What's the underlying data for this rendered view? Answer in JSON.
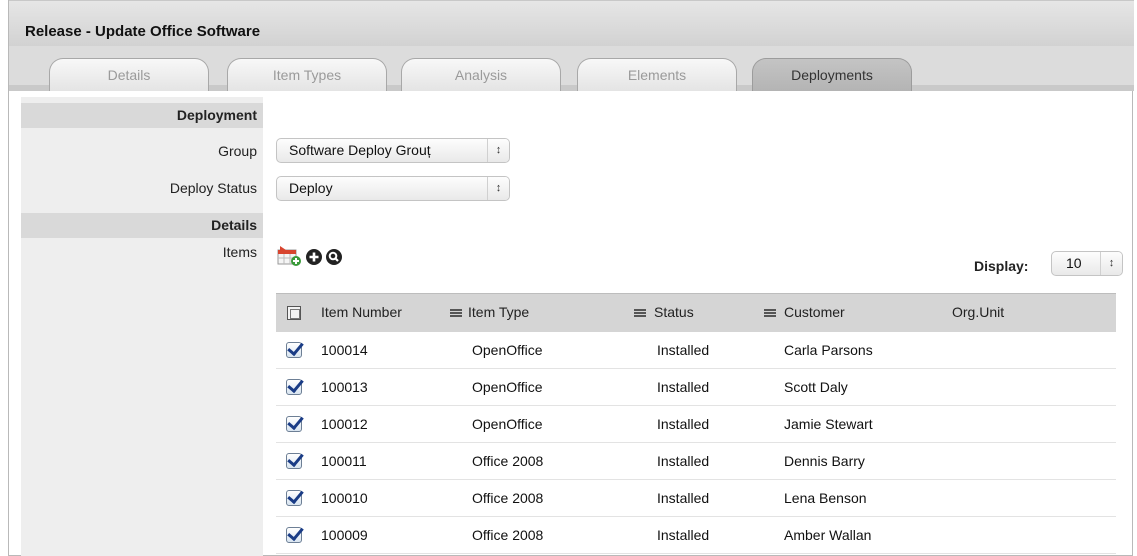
{
  "window": {
    "title": "Release - Update Office Software"
  },
  "tabs": [
    {
      "label": "Details",
      "active": false
    },
    {
      "label": "Item Types",
      "active": false
    },
    {
      "label": "Analysis",
      "active": false
    },
    {
      "label": "Elements",
      "active": false
    },
    {
      "label": "Deployments",
      "active": true
    }
  ],
  "deployment": {
    "section_label": "Deployment",
    "group_label": "Group",
    "group_value": "Software Deploy Grouț",
    "status_label": "Deploy Status",
    "status_value": "Deploy"
  },
  "details": {
    "section_label": "Details",
    "items_label": "Items"
  },
  "toolbar_icons": [
    "add-item-icon",
    "add-circle-icon",
    "search-circle-icon"
  ],
  "display": {
    "label": "Display:",
    "value": "10"
  },
  "table": {
    "columns": [
      "Item Number",
      "Item Type",
      "Status",
      "Customer",
      "Org.Unit"
    ],
    "rows": [
      {
        "number": "100014",
        "type": "OpenOffice",
        "status": "Installed",
        "customer": "Carla Parsons",
        "org": "",
        "checked": true
      },
      {
        "number": "100013",
        "type": "OpenOffice",
        "status": "Installed",
        "customer": "Scott Daly",
        "org": "",
        "checked": true
      },
      {
        "number": "100012",
        "type": "OpenOffice",
        "status": "Installed",
        "customer": "Jamie Stewart",
        "org": "",
        "checked": true
      },
      {
        "number": "100011",
        "type": "Office 2008",
        "status": "Installed",
        "customer": "Dennis Barry",
        "org": "",
        "checked": true
      },
      {
        "number": "100010",
        "type": "Office 2008",
        "status": "Installed",
        "customer": "Lena Benson",
        "org": "",
        "checked": true
      },
      {
        "number": "100009",
        "type": "Office 2008",
        "status": "Installed",
        "customer": "Amber Wallan",
        "org": "",
        "checked": true
      }
    ]
  },
  "colors": {
    "tab_active": "#b9b9b9",
    "section_header": "#d9d9d9",
    "left_column": "#eeeeee",
    "checkbox_mark": "#1a3c86"
  }
}
